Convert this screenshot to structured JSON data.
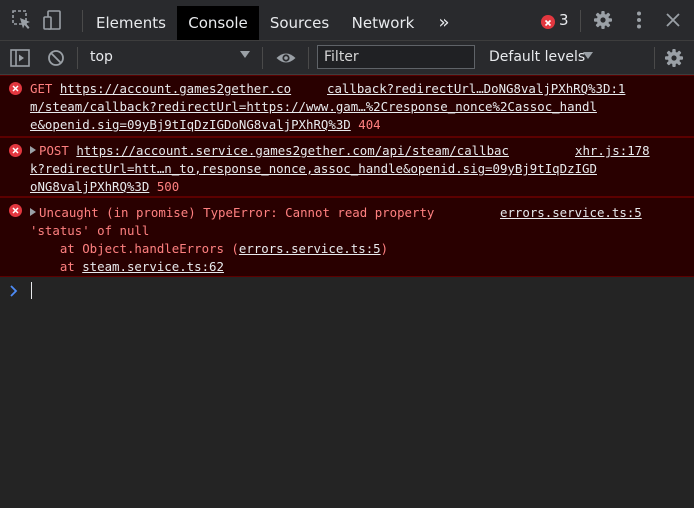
{
  "tabs": {
    "elements": "Elements",
    "console": "Console",
    "sources": "Sources",
    "network": "Network",
    "more": "»",
    "error_count": "3"
  },
  "toolbar": {
    "context": "top",
    "filter_placeholder": "Filter",
    "levels": "Default levels"
  },
  "messages": [
    {
      "lines": [
        {
          "prefix": "GET ",
          "link": "https://account.games2gether.co"
        },
        {
          "link": "m/steam/callback?redirectUrl=https://www.gam…%2Cresponse_nonce%2Cassoc_handl"
        },
        {
          "link": "e&openid.sig=09yBj9tIqDzIGDoNG8valjPXhRQ%3D",
          "suffix": " 404"
        }
      ],
      "source": "callback?redirectUrl…DoNG8valjPXhRQ%3D:1"
    },
    {
      "lines": [
        {
          "prefix": "POST ",
          "link": "https://account.service.games2gether.com/api/steam/callbac"
        },
        {
          "link": "k?redirectUrl=htt…n_to,response_nonce,assoc_handle&openid.sig=09yBj9tIqDzIGD"
        },
        {
          "link": "oNG8valjPXhRQ%3D",
          "suffix": " 500"
        }
      ],
      "source": "xhr.js:178"
    },
    {
      "lines": [
        {
          "text": "Uncaught (in promise) TypeError: Cannot read property"
        },
        {
          "text": "'status' of null"
        },
        {
          "text": "    at Object.handleErrors (",
          "link": "errors.service.ts:5",
          "suffix": ")"
        },
        {
          "text": "    at ",
          "link": "steam.service.ts:62"
        }
      ],
      "source": "errors.service.ts:5"
    }
  ],
  "colors": {
    "error_bg": "#290000",
    "error_text": "#ff8080",
    "error_icon": "#e2373f",
    "active_tab": "#000000"
  }
}
